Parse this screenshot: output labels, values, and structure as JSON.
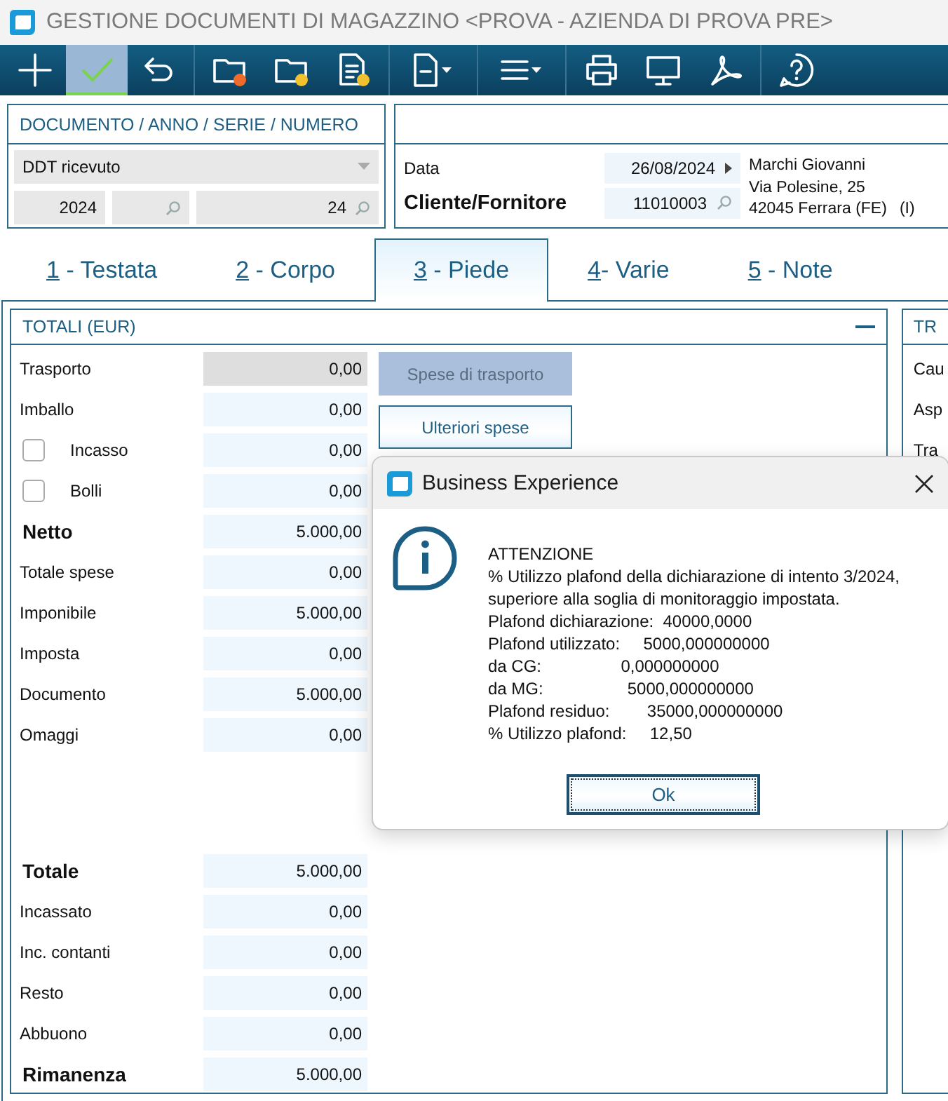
{
  "window": {
    "title": "GESTIONE DOCUMENTI DI MAGAZZINO <PROVA - AZIENDA DI PROVA PRE>"
  },
  "toolbar": {
    "groups": [
      {
        "buttons": [
          {
            "kind": "add",
            "selected": false
          },
          {
            "kind": "confirm",
            "selected": true
          },
          {
            "kind": "undo",
            "selected": false
          }
        ]
      },
      {
        "buttons": [
          {
            "kind": "folder_orange",
            "selected": false
          },
          {
            "kind": "folder_yellow",
            "selected": false
          },
          {
            "kind": "document_yellow",
            "selected": false
          }
        ]
      },
      {
        "buttons": [
          {
            "kind": "document_menu",
            "selected": false
          }
        ]
      },
      {
        "buttons": [
          {
            "kind": "list_menu",
            "selected": false
          }
        ]
      },
      {
        "buttons": [
          {
            "kind": "print",
            "selected": false
          },
          {
            "kind": "monitor",
            "selected": false
          },
          {
            "kind": "pdf",
            "selected": false
          }
        ]
      },
      {
        "buttons": [
          {
            "kind": "help",
            "selected": false
          }
        ]
      }
    ]
  },
  "document": {
    "label": "DOCUMENTO / ANNO / SERIE / NUMERO",
    "type": "DDT ricevuto",
    "year": "2024",
    "number": "24"
  },
  "header": {
    "date_label": "Data",
    "date": "26/08/2024",
    "party_label": "Cliente/Fornitore",
    "party_code": "11010003",
    "address_lines": [
      "Marchi Giovanni",
      "Via Polesine, 25",
      "42045 Ferrara (FE)"
    ],
    "country": "(I)"
  },
  "tabs": [
    {
      "key": "1",
      "label": " - Testata",
      "selected": false
    },
    {
      "key": "2",
      "label": " - Corpo",
      "selected": false
    },
    {
      "key": "3",
      "label": " - Piede",
      "selected": true
    },
    {
      "key": "4",
      "label": "- Varie",
      "selected": false
    },
    {
      "key": "5",
      "label": " - Note",
      "selected": false
    }
  ],
  "totals": {
    "title": "TOTALI (EUR)",
    "rows": [
      {
        "kind": "value",
        "label": "Trasporto",
        "value": "0,00",
        "readonly": true
      },
      {
        "kind": "value",
        "label": "Imballo",
        "value": "0,00",
        "readonly": false
      },
      {
        "kind": "check",
        "label": "Incasso",
        "value": "0,00",
        "checked": false,
        "readonly": false
      },
      {
        "kind": "check",
        "label": "Bolli",
        "value": "0,00",
        "checked": false,
        "readonly": false
      },
      {
        "kind": "total",
        "label": "Netto",
        "value": "5.000,00",
        "readonly": false
      },
      {
        "kind": "value",
        "label": "Totale spese",
        "value": "0,00",
        "readonly": false
      },
      {
        "kind": "value",
        "label": "Imponibile",
        "value": "5.000,00",
        "readonly": false
      },
      {
        "kind": "value",
        "label": "Imposta",
        "value": "0,00",
        "readonly": false
      },
      {
        "kind": "value",
        "label": "Documento",
        "value": "5.000,00",
        "readonly": false
      },
      {
        "kind": "value",
        "label": "Omaggi",
        "value": "0,00",
        "readonly": false
      }
    ],
    "summary_rows": [
      {
        "kind": "total",
        "label": "Totale",
        "value": "5.000,00",
        "readonly": false
      },
      {
        "kind": "value",
        "label": "Incassato",
        "value": "0,00",
        "readonly": false
      },
      {
        "kind": "value",
        "label": "Inc. contanti",
        "value": "0,00",
        "readonly": false
      },
      {
        "kind": "value",
        "label": "Resto",
        "value": "0,00",
        "readonly": false
      },
      {
        "kind": "value",
        "label": "Abbuono",
        "value": "0,00",
        "readonly": false
      },
      {
        "kind": "total",
        "label": "Rimanenza",
        "value": "5.000,00",
        "readonly": false
      }
    ],
    "buttons": [
      {
        "label": "Spese di trasporto",
        "disabled": true
      },
      {
        "label": "Ulteriori spese",
        "disabled": false
      }
    ]
  },
  "side_panel": {
    "title": "TR",
    "labels": [
      "Cau",
      "Asp",
      "Tra"
    ]
  },
  "dialog": {
    "title": "Business Experience",
    "lines": [
      "ATTENZIONE",
      "% Utilizzo plafond della dichiarazione di intento 3/2024,",
      "superiore alla soglia di monitoraggio impostata.",
      "Plafond dichiarazione:  40000,0000",
      "Plafond utilizzato:     5000,000000000",
      "da CG:                 0,000000000",
      "da MG:                  5000,000000000",
      "Plafond residuo:        35000,000000000",
      "% Utilizzo plafond:     12,50"
    ],
    "button": "Ok"
  }
}
